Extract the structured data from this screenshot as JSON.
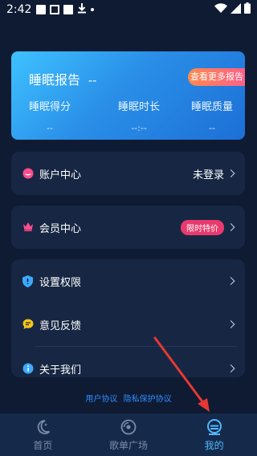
{
  "status_bar": {
    "time": "2:42"
  },
  "report": {
    "title": "睡眠报告",
    "title_value": "--",
    "more_button": "查看更多报告",
    "stats": [
      {
        "label": "睡眠得分",
        "value": "--"
      },
      {
        "label": "睡眠时长",
        "value": "--:--"
      },
      {
        "label": "睡眠质量",
        "value": "--"
      }
    ]
  },
  "account": {
    "label": "账户中心",
    "status": "未登录",
    "icon": "smiley-icon"
  },
  "membership": {
    "label": "会员中心",
    "badge": "限时特价",
    "icon": "crown-icon"
  },
  "settings_list": [
    {
      "label": "设置权限",
      "icon": "shield-icon"
    },
    {
      "label": "意见反馈",
      "icon": "chat-icon"
    },
    {
      "label": "关于我们",
      "icon": "info-icon"
    }
  ],
  "agreements": {
    "user": "用户协议",
    "privacy": "隐私保护协议"
  },
  "bottom_nav": [
    {
      "label": "首页",
      "icon": "moon-icon",
      "active": false
    },
    {
      "label": "歌单广场",
      "icon": "disc-icon",
      "active": false
    },
    {
      "label": "我的",
      "icon": "profile-icon",
      "active": true
    }
  ],
  "colors": {
    "background": "#0f1b33",
    "card": "#172743",
    "accent": "#4fb8ff",
    "badge": "#e83a6e",
    "annotation": "#e53935"
  }
}
